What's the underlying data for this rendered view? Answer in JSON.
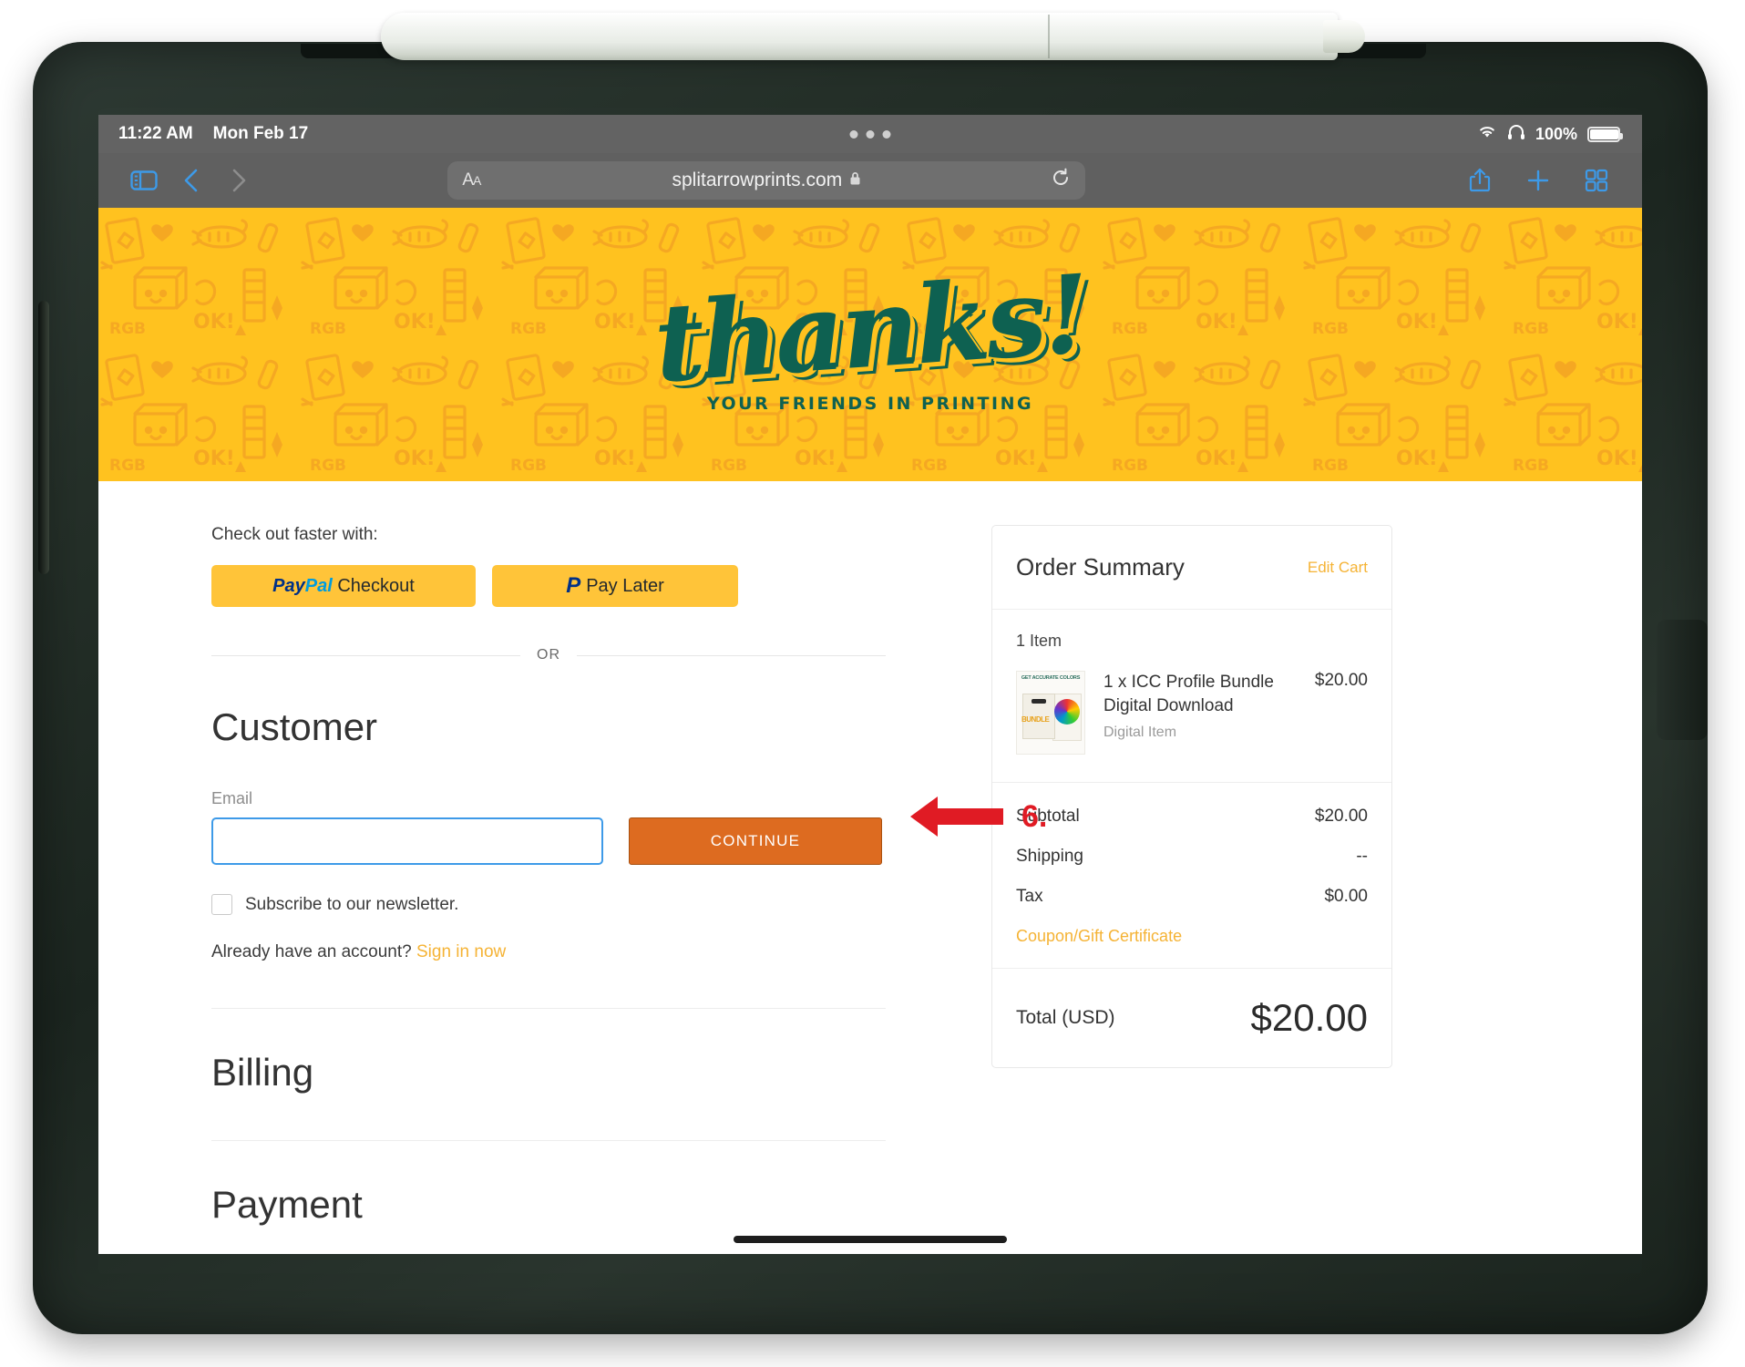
{
  "device": {
    "name": "iPad with case and Apple Pencil",
    "accessory": "apple-pencil"
  },
  "status_bar": {
    "time": "11:22 AM",
    "date": "Mon Feb 17",
    "wifi_icon": "wifi-icon",
    "headphones_icon": "headphones-icon",
    "battery_percent": "100%",
    "battery_icon": "battery-full-icon",
    "multitask_dots": "multitasking-dots-icon"
  },
  "browser": {
    "sidebar_icon": "sidebar-toggle-icon",
    "back_icon": "back-chevron-icon",
    "forward_icon": "forward-chevron-icon",
    "text_size_label": "AA",
    "url": "splitarrowprints.com",
    "lock_icon": "lock-icon",
    "reload_icon": "reload-icon",
    "share_icon": "share-icon",
    "new_tab_icon": "plus-icon",
    "tabs_icon": "tab-overview-icon"
  },
  "banner": {
    "logo_text": "thanks!",
    "tagline": "YOUR FRIENDS IN PRINTING",
    "bg_color": "#ffc21f",
    "pattern_color": "#f5a623",
    "logo_color": "#0e6151"
  },
  "checkout": {
    "faster_label": "Check out faster with:",
    "paypal_checkout": {
      "brand_pay": "Pay",
      "brand_pal": "Pal",
      "label": "Checkout"
    },
    "paypal_later": {
      "glyph": "P",
      "label": "Pay Later"
    },
    "or_label": "OR",
    "customer_heading": "Customer",
    "email_label": "Email",
    "email_value": "",
    "email_placeholder": "",
    "continue_label": "CONTINUE",
    "newsletter_label": "Subscribe to our newsletter.",
    "newsletter_checked": false,
    "account_prompt": "Already have an account?",
    "signin_link": "Sign in now",
    "billing_heading": "Billing",
    "payment_heading": "Payment"
  },
  "order_summary": {
    "title": "Order Summary",
    "edit_cart": "Edit Cart",
    "item_count": "1 Item",
    "items": [
      {
        "name": "1 x ICC Profile Bundle Digital Download",
        "sub": "Digital Item",
        "price": "$20.00",
        "thumb_headline": "GET ACCURATE COLORS",
        "thumb_word": "BUNDLE"
      }
    ],
    "totals": [
      {
        "label": "Subtotal",
        "value": "$20.00"
      },
      {
        "label": "Shipping",
        "value": "--"
      },
      {
        "label": "Tax",
        "value": "$0.00"
      }
    ],
    "coupon_link": "Coupon/Gift Certificate",
    "total_label": "Total (USD)",
    "total_value": "$20.00"
  },
  "annotation": {
    "step_number": "6.",
    "arrow": "left-arrow-icon",
    "color": "#e01b24"
  }
}
